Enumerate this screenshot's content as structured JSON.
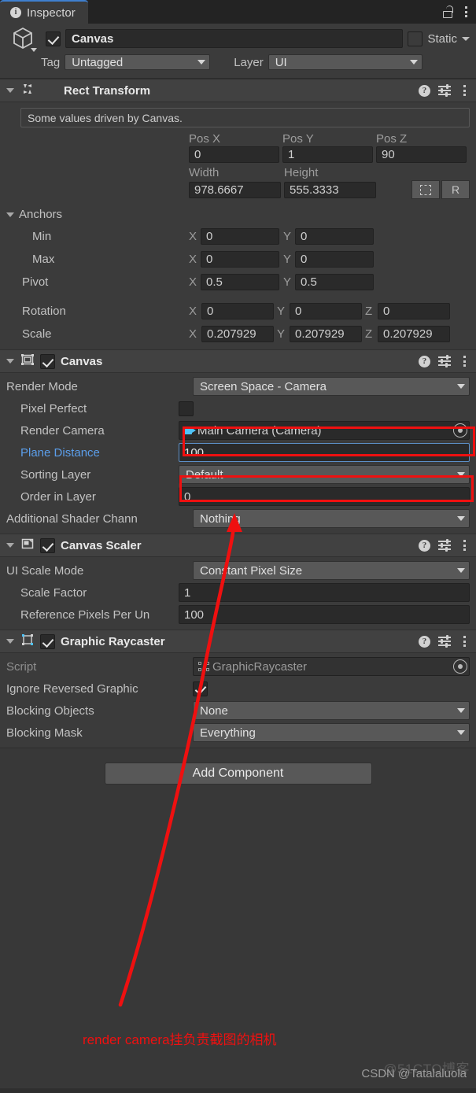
{
  "window": {
    "tab_label": "Inspector",
    "tab_icon": "info-icon",
    "lock_icon": "unlocked-padlock-icon",
    "menu_icon": "kebab-menu-icon"
  },
  "object_header": {
    "icon": "prefab-cube-icon",
    "enabled": true,
    "name": "Canvas",
    "static_label": "Static",
    "static_checked": false,
    "tag_label": "Tag",
    "tag_value": "Untagged",
    "layer_label": "Layer",
    "layer_value": "UI"
  },
  "rect_transform": {
    "title": "Rect Transform",
    "icon": "rect-transform-icon",
    "expanded": true,
    "helpbox": "Some values driven by Canvas.",
    "pos_headers": [
      "Pos X",
      "Pos Y",
      "Pos Z"
    ],
    "pos_values": [
      "0",
      "1",
      "90"
    ],
    "size_headers": [
      "Width",
      "Height"
    ],
    "size_values": [
      "978.6667",
      "555.3333"
    ],
    "anchor_preset_btn": "blueprint-mode-button",
    "raw_edit_btn": "R",
    "anchors_label": "Anchors",
    "anchor_rows": [
      {
        "label": "Min",
        "x": "0",
        "y": "0"
      },
      {
        "label": "Max",
        "x": "0",
        "y": "0"
      },
      {
        "label": "Pivot",
        "x": "0.5",
        "y": "0.5"
      }
    ],
    "rotation": {
      "label": "Rotation",
      "x": "0",
      "y": "0",
      "z": "0"
    },
    "scale": {
      "label": "Scale",
      "x": "0.207929",
      "y": "0.207929",
      "z": "0.207929"
    },
    "axis_labels": [
      "X",
      "Y",
      "Z"
    ]
  },
  "canvas": {
    "title": "Canvas",
    "icon": "canvas-icon",
    "enabled": true,
    "rows": {
      "render_mode_label": "Render Mode",
      "render_mode_value": "Screen Space - Camera",
      "pixel_perfect_label": "Pixel Perfect",
      "pixel_perfect_checked": false,
      "render_camera_label": "Render Camera",
      "render_camera_value": "Main Camera (Camera)",
      "render_camera_icon": "camera-icon",
      "plane_distance_label": "Plane Distance",
      "plane_distance_value": "100",
      "sorting_layer_label": "Sorting Layer",
      "sorting_layer_value": "Default",
      "order_in_layer_label": "Order in Layer",
      "order_in_layer_value": "0",
      "additional_shader_label": "Additional Shader Chann",
      "additional_shader_value": "Nothing"
    }
  },
  "canvas_scaler": {
    "title": "Canvas Scaler",
    "icon": "canvas-scaler-icon",
    "enabled": true,
    "rows": {
      "ui_scale_mode_label": "UI Scale Mode",
      "ui_scale_mode_value": "Constant Pixel Size",
      "scale_factor_label": "Scale Factor",
      "scale_factor_value": "1",
      "ref_pixels_label": "Reference Pixels Per Un",
      "ref_pixels_value": "100"
    }
  },
  "graphic_raycaster": {
    "title": "Graphic Raycaster",
    "icon": "graphic-raycaster-icon",
    "enabled": true,
    "rows": {
      "script_label": "Script",
      "script_value": "GraphicRaycaster",
      "ignore_reversed_label": "Ignore Reversed Graphic",
      "ignore_reversed_checked": true,
      "blocking_objects_label": "Blocking Objects",
      "blocking_objects_value": "None",
      "blocking_mask_label": "Blocking Mask",
      "blocking_mask_value": "Everything"
    }
  },
  "add_component": {
    "label": "Add Component"
  },
  "annotations": {
    "note_text": "render camera挂负责截图的相机",
    "note_color": "#ef1010",
    "highlight_color": "#ef1010",
    "arrow_color": "#ef1010"
  },
  "watermark": {
    "text": "CSDN @Tatalaluola",
    "ghost_text": "@51CTO博客"
  }
}
